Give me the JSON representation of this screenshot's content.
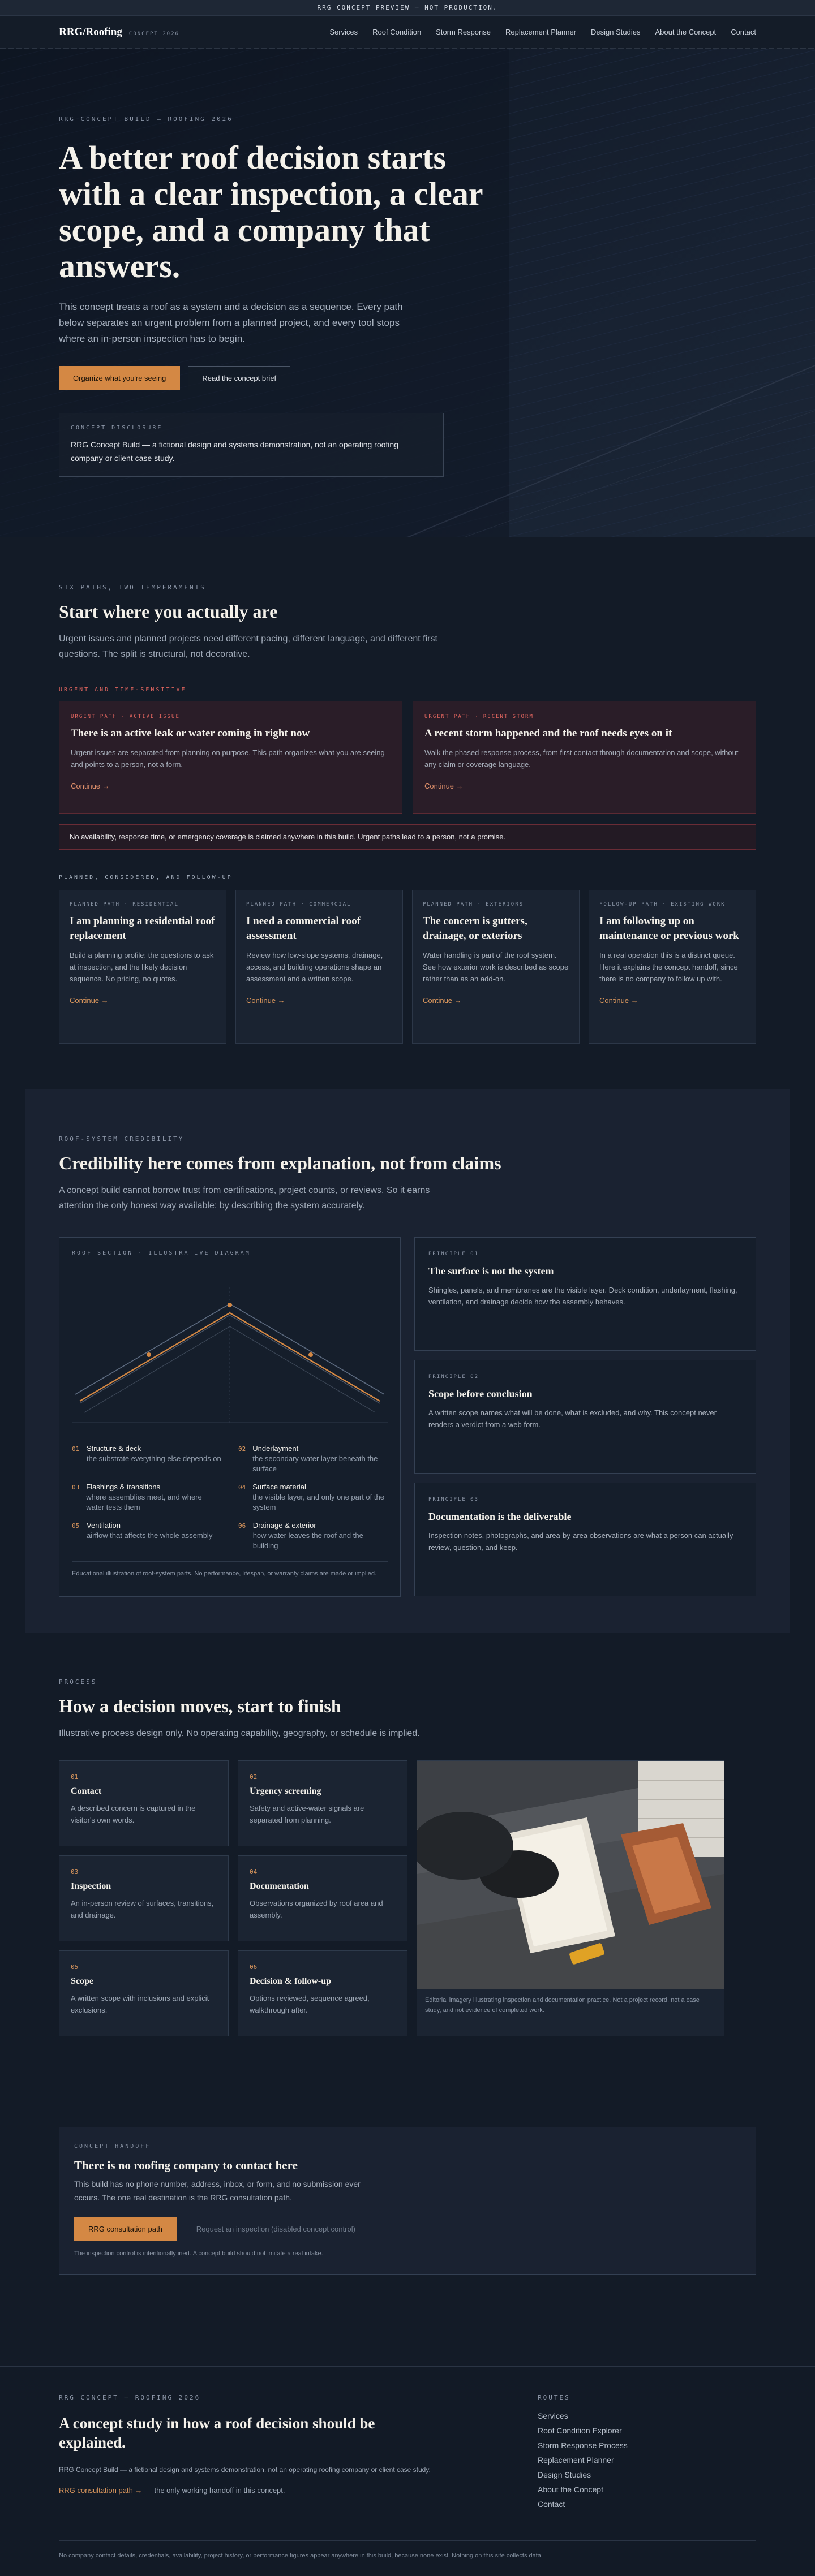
{
  "preview_bar": "RRG CONCEPT PREVIEW — NOT PRODUCTION.",
  "nav": {
    "brand": "RRG/Roofing",
    "tag": "CONCEPT 2026",
    "links": [
      "Services",
      "Roof Condition",
      "Storm Response",
      "Replacement Planner",
      "Design Studies",
      "About the Concept",
      "Contact"
    ]
  },
  "hero": {
    "eyebrow": "RRG CONCEPT BUILD — ROOFING 2026",
    "title": "A better roof decision starts with a clear inspection, a clear scope, and a company that answers.",
    "lead": "This concept treats a roof as a system and a decision as a sequence. Every path below separates an urgent problem from a planned project, and every tool stops where an in-person inspection has to begin.",
    "primary_cta": "Organize what you're seeing",
    "secondary_cta": "Read the concept brief",
    "disclosure_label": "CONCEPT DISCLOSURE",
    "disclosure_text": "RRG Concept Build — a fictional design and systems demonstration, not an operating roofing company or client case study."
  },
  "paths": {
    "eyebrow": "SIX PATHS, TWO TEMPERAMENTS",
    "title": "Start where you actually are",
    "lead": "Urgent issues and planned projects need different pacing, different language, and different first questions. The split is structural, not decorative.",
    "urgent_label": "URGENT AND TIME-SENSITIVE",
    "urgent": [
      {
        "eyebrow": "URGENT PATH · ACTIVE ISSUE",
        "title": "There is an active leak or water coming in right now",
        "body": "Urgent issues are separated from planning on purpose. This path organizes what you are seeing and points to a person, not a form.",
        "cta": "Continue"
      },
      {
        "eyebrow": "URGENT PATH · RECENT STORM",
        "title": "A recent storm happened and the roof needs eyes on it",
        "body": "Walk the phased response process, from first contact through documentation and scope, without any claim or coverage language.",
        "cta": "Continue"
      }
    ],
    "notice": "No availability, response time, or emergency coverage is claimed anywhere in this build. Urgent paths lead to a person, not a promise.",
    "planned_label": "PLANNED, CONSIDERED, AND FOLLOW-UP",
    "planned": [
      {
        "eyebrow": "PLANNED PATH · RESIDENTIAL",
        "title": "I am planning a residential roof replacement",
        "body": "Build a planning profile: the questions to ask at inspection, and the likely decision sequence. No pricing, no quotes.",
        "cta": "Continue"
      },
      {
        "eyebrow": "PLANNED PATH · COMMERCIAL",
        "title": "I need a commercial roof assessment",
        "body": "Review how low-slope systems, drainage, access, and building operations shape an assessment and a written scope.",
        "cta": "Continue"
      },
      {
        "eyebrow": "PLANNED PATH · EXTERIORS",
        "title": "The concern is gutters, drainage, or exteriors",
        "body": "Water handling is part of the roof system. See how exterior work is described as scope rather than as an add-on.",
        "cta": "Continue"
      },
      {
        "eyebrow": "FOLLOW-UP PATH · EXISTING WORK",
        "title": "I am following up on maintenance or previous work",
        "body": "In a real operation this is a distinct queue. Here it explains the concept handoff, since there is no company to follow up with.",
        "cta": "Continue"
      }
    ]
  },
  "cred": {
    "eyebrow": "ROOF-SYSTEM CREDIBILITY",
    "title": "Credibility here comes from explanation, not from claims",
    "lead": "A concept build cannot borrow trust from certifications, project counts, or reviews. So it earns attention the only honest way available: by describing the system accurately.",
    "diagram_label": "ROOF SECTION · ILLUSTRATIVE DIAGRAM",
    "legend": [
      {
        "num": "01",
        "title": "Structure & deck",
        "desc": "the substrate everything else depends on"
      },
      {
        "num": "02",
        "title": "Underlayment",
        "desc": "the secondary water layer beneath the surface"
      },
      {
        "num": "03",
        "title": "Flashings & transitions",
        "desc": "where assemblies meet, and where water tests them"
      },
      {
        "num": "04",
        "title": "Surface material",
        "desc": "the visible layer, and only one part of the system"
      },
      {
        "num": "05",
        "title": "Ventilation",
        "desc": "airflow that affects the whole assembly"
      },
      {
        "num": "06",
        "title": "Drainage & exterior",
        "desc": "how water leaves the roof and the building"
      }
    ],
    "diagram_caption": "Educational illustration of roof-system parts. No performance, lifespan, or warranty claims are made or implied.",
    "principles": [
      {
        "eyebrow": "PRINCIPLE 01",
        "title": "The surface is not the system",
        "body": "Shingles, panels, and membranes are the visible layer. Deck condition, underlayment, flashing, ventilation, and drainage decide how the assembly behaves."
      },
      {
        "eyebrow": "PRINCIPLE 02",
        "title": "Scope before conclusion",
        "body": "A written scope names what will be done, what is excluded, and why. This concept never renders a verdict from a web form."
      },
      {
        "eyebrow": "PRINCIPLE 03",
        "title": "Documentation is the deliverable",
        "body": "Inspection notes, photographs, and area-by-area observations are what a person can actually review, question, and keep."
      }
    ]
  },
  "process": {
    "eyebrow": "PROCESS",
    "title": "How a decision moves, start to finish",
    "lead": "Illustrative process design only. No operating capability, geography, or schedule is implied.",
    "steps": [
      {
        "num": "01",
        "title": "Contact",
        "body": "A described concern is captured in the visitor's own words."
      },
      {
        "num": "02",
        "title": "Urgency screening",
        "body": "Safety and active-water signals are separated from planning."
      },
      {
        "num": "03",
        "title": "Inspection",
        "body": "An in-person review of surfaces, transitions, and drainage."
      },
      {
        "num": "04",
        "title": "Documentation",
        "body": "Observations organized by roof area and assembly."
      },
      {
        "num": "05",
        "title": "Scope",
        "body": "A written scope with inclusions and explicit exclusions."
      },
      {
        "num": "06",
        "title": "Decision & follow-up",
        "body": "Options reviewed, sequence agreed, walkthrough after."
      }
    ],
    "photo_caption": "Editorial imagery illustrating inspection and documentation practice. Not a project record, not a case study, and not evidence of completed work."
  },
  "handoff": {
    "eyebrow": "CONCEPT HANDOFF",
    "title": "There is no roofing company to contact here",
    "body": "This build has no phone number, address, inbox, or form, and no submission ever occurs. The one real destination is the RRG consultation path.",
    "primary": "RRG consultation path",
    "disabled": "Request an inspection (disabled concept control)",
    "note": "The inspection control is intentionally inert. A concept build should not imitate a real intake."
  },
  "footer": {
    "eyebrow": "RRG CONCEPT — ROOFING 2026",
    "title": "A concept study in how a roof decision should be explained.",
    "text": "RRG Concept Build — a fictional design and systems demonstration, not an operating roofing company or client case study.",
    "link": "RRG consultation path",
    "link_rest": "— the only working handoff in this concept.",
    "routes_label": "ROUTES",
    "routes": [
      "Services",
      "Roof Condition Explorer",
      "Storm Response Process",
      "Replacement Planner",
      "Design Studies",
      "About the Concept",
      "Contact"
    ],
    "bottom": "No company contact details, credentials, availability, project history, or performance figures appear anywhere in this build, because none exist. Nothing on this site collects data."
  },
  "colors": {
    "accent": "#d48844",
    "urgent": "#e0655f",
    "background": "#131b27"
  },
  "icons": [
    "arrow-right-icon"
  ]
}
